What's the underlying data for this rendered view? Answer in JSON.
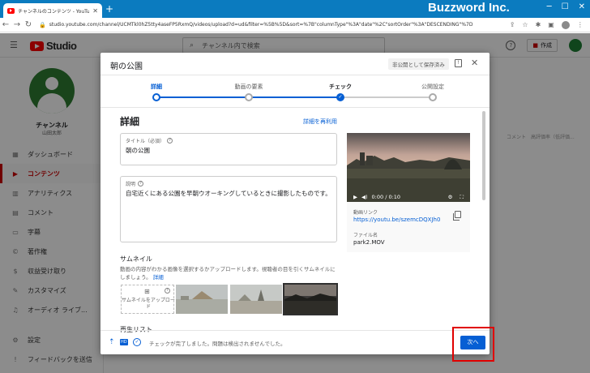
{
  "browser": {
    "tab_title": "チャンネルのコンテンツ - YouTube Stu",
    "new_tab": "+",
    "brand": "Buzzword Inc.",
    "url": "studio.youtube.com/channel/UCMTkl0hZ5tty4aseFP5RxmQ/videos/upload?d=ud&filter=%5B%5D&sort=%7B\"columnType\"%3A\"date\"%2C\"sortOrder\"%3A\"DESCENDING\"%7D"
  },
  "studio": {
    "logo_text": "Studio",
    "search_placeholder": "チャンネル内で検索",
    "create_label": "作成"
  },
  "sidebar": {
    "channel_name": "チャンネル",
    "channel_sub": "山田太郎",
    "items": [
      {
        "label": "ダッシュボード",
        "icon": "dashboard-icon"
      },
      {
        "label": "コンテンツ",
        "icon": "content-icon",
        "active": true
      },
      {
        "label": "アナリティクス",
        "icon": "analytics-icon"
      },
      {
        "label": "コメント",
        "icon": "comments-icon"
      },
      {
        "label": "字幕",
        "icon": "subtitles-icon"
      },
      {
        "label": "著作権",
        "icon": "copyright-icon"
      },
      {
        "label": "収益受け取り",
        "icon": "monetization-icon"
      },
      {
        "label": "カスタマイズ",
        "icon": "customize-icon"
      },
      {
        "label": "オーディオ ライブ...",
        "icon": "audio-library-icon"
      }
    ],
    "bottom_items": [
      {
        "label": "設定",
        "icon": "settings-icon"
      },
      {
        "label": "フィードバックを送信",
        "icon": "feedback-icon"
      }
    ]
  },
  "background": {
    "list_headers": "コメント　高評価率（低評価..."
  },
  "dialog": {
    "title": "朝の公園",
    "save_private": "非公開として保存済み",
    "steps": [
      {
        "label": "詳細",
        "state": "done-active"
      },
      {
        "label": "動画の要素",
        "state": "pending"
      },
      {
        "label": "チェック",
        "state": "current"
      },
      {
        "label": "公開設定",
        "state": "pending"
      }
    ],
    "section_title": "詳細",
    "reuse_link": "詳細を再利用",
    "title_field": {
      "label": "タイトル（必須）",
      "value": "朝の公園"
    },
    "desc_field": {
      "label": "説明",
      "value": "自宅近くにある公園を早朝ウオーキングしているときに撮影したものです。"
    },
    "thumbnail": {
      "title": "サムネイル",
      "desc": "動画の内容がわかる画像を選択するかアップロードします。視聴者の目を引くサムネイルにしましょう。",
      "more": "詳細",
      "upload_label": "サムネイルをアップロード"
    },
    "playlist_title": "再生リスト",
    "video": {
      "time": "0:00 / 0:10",
      "link_label": "動画リンク",
      "link": "https://youtu.be/szemcDQXJh0",
      "filename_label": "ファイル名",
      "filename": "park2.MOV"
    },
    "footer": {
      "status": "チェックが完了しました。問題は検出されませんでした。",
      "next_button": "次へ"
    }
  },
  "colors": {
    "accent": "#065fd4",
    "titlebar": "#0b7bbf",
    "active_nav": "#cc0000",
    "highlight": "#e00000"
  }
}
